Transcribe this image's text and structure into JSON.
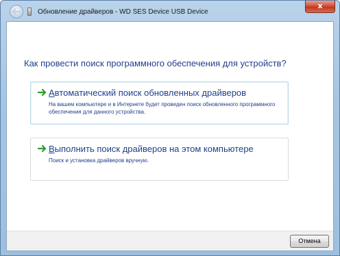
{
  "window": {
    "title": "Обновление драйверов - WD SES Device USB Device",
    "close_label": "x"
  },
  "main": {
    "question": "Как провести поиск программного обеспечения для устройств?",
    "options": [
      {
        "title_access_key": "А",
        "title_rest": "втоматический поиск обновленных драйверов",
        "description": "На вашем компьютере и в Интернете будет проведен поиск обновленного программного обеспечения для данного устройства."
      },
      {
        "title_access_key": "В",
        "title_rest": "ыполнить поиск драйверов на этом компьютере",
        "description": "Поиск и установка драйверов вручную."
      }
    ]
  },
  "footer": {
    "cancel_label": "Отмена"
  },
  "icons": {
    "back": "back-arrow-icon",
    "device": "usb-device-icon",
    "option_arrow": "green-arrow-icon"
  },
  "colors": {
    "link_blue": "#1e3f8a",
    "arrow_green": "#2e9b2e",
    "close_red": "#c0391f"
  }
}
